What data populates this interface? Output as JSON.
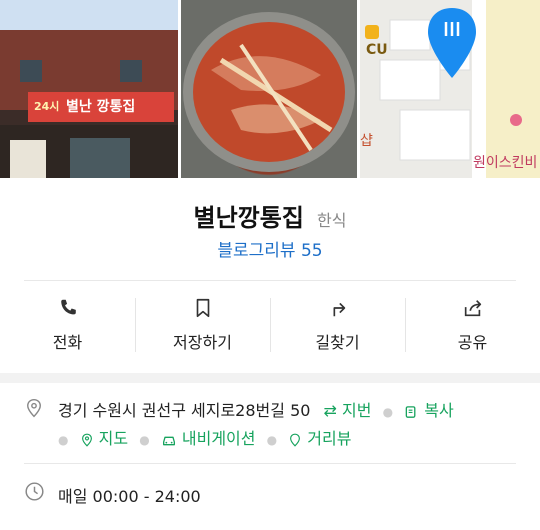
{
  "map": {
    "poi_cu": "CU",
    "poi_shop": "샵",
    "poi_onepiece": "원이스킨비"
  },
  "place": {
    "name": "별난깡통집",
    "category": "한식",
    "review_label": "블로그리뷰 55"
  },
  "sign": {
    "hours_tag": "24시",
    "shop_name": "별난 깡통집"
  },
  "actions": [
    {
      "label": "전화",
      "icon": "phone-icon"
    },
    {
      "label": "저장하기",
      "icon": "bookmark-icon"
    },
    {
      "label": "길찾기",
      "icon": "directions-icon"
    },
    {
      "label": "공유",
      "icon": "share-icon"
    }
  ],
  "info": {
    "address": "경기 수원시 권선구 세지로28번길 50",
    "jibun": "지번",
    "copy": "복사",
    "map": "지도",
    "navigation": "내비게이션",
    "street_view": "거리뷰",
    "hours": "매일 00:00 - 24:00"
  },
  "colors": {
    "accent_blue": "#1e6fc8",
    "green": "#17a35e",
    "map_pin": "#1a8cf0"
  }
}
